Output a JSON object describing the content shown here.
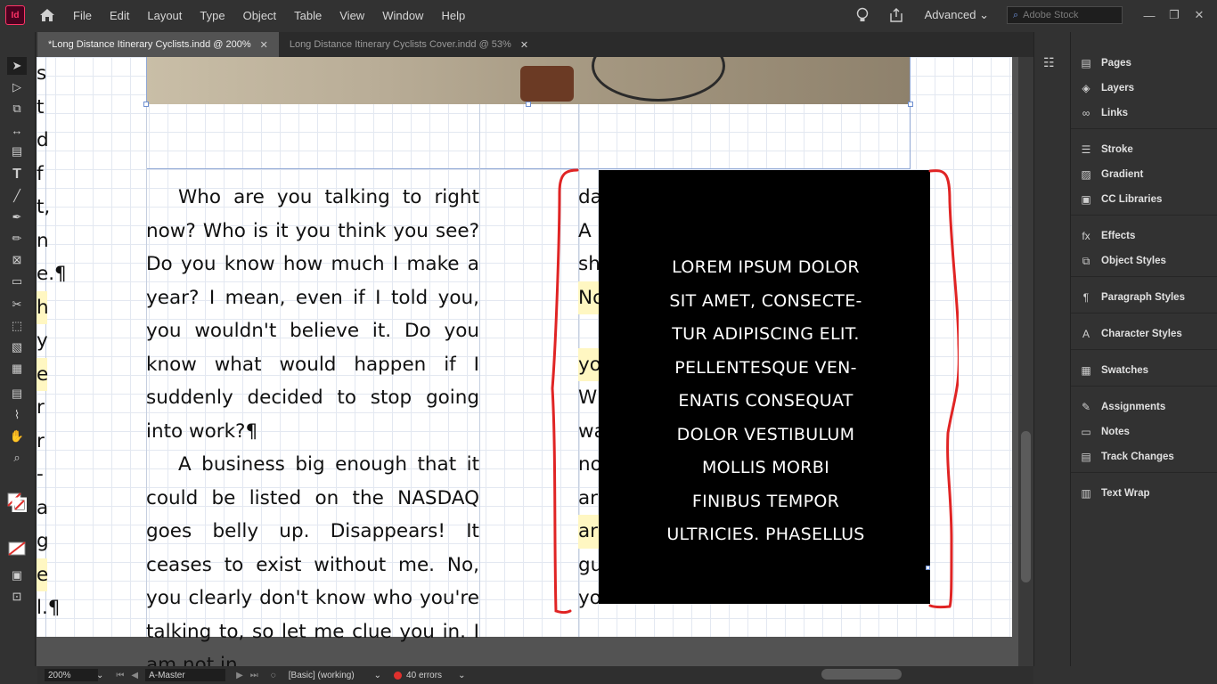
{
  "app": {
    "logo": "Id"
  },
  "menu": [
    "File",
    "Edit",
    "Layout",
    "Type",
    "Object",
    "Table",
    "View",
    "Window",
    "Help"
  ],
  "workspace": "Advanced",
  "stock_placeholder": "Adobe Stock",
  "window_controls": [
    "—",
    "❐",
    "✕"
  ],
  "tabs": [
    {
      "label": "*Long Distance Itinerary Cyclists.indd @ 200%"
    },
    {
      "label": "Long Distance Itinerary Cyclists Cover.indd @ 53%"
    }
  ],
  "tab_close": "✕",
  "left_column_chars": [
    "s",
    "t",
    "d",
    "f",
    "t,",
    "n",
    "e.¶",
    "h",
    "y",
    "e",
    "r",
    "r",
    "-",
    "a",
    "g",
    "e",
    "l.¶"
  ],
  "body": {
    "para1": "Who are you talking to right now? Who is it you think you see? Do you know how much I make a year? I mean, even if I told you, you wouldn't believe it. Do you know what would happen if I suddenly decided to stop going into work?¶",
    "para2": "A business big enough that it could be listed on the NASDAQ goes belly up. Disappears! It ceases to exist without me. No, you clearly don't know who you're talking to, so let me clue you in. I am not in"
  },
  "right_column_fragments": [
    "da",
    "A",
    "sh",
    "No",
    "",
    "yo",
    "W",
    "wa",
    "no",
    "ar",
    "ar",
    "gu",
    "yo"
  ],
  "overlay_text": [
    "LOREM IPSUM DOLOR",
    "SIT AMET, CONSECTE-",
    "TUR ADIPISCING ELIT.",
    "PELLENTESQUE VEN-",
    "ENATIS CONSEQUAT",
    "DOLOR VESTIBULUM",
    "MOLLIS MORBI",
    "FINIBUS TEMPOR",
    "ULTRICIES. PHASELLUS"
  ],
  "panels": [
    {
      "label": "Pages",
      "icon": "pages-icon",
      "glyph": "▤"
    },
    {
      "label": "Layers",
      "icon": "layers-icon",
      "glyph": "◈"
    },
    {
      "label": "Links",
      "icon": "links-icon",
      "glyph": "∞"
    },
    {
      "label": "Stroke",
      "icon": "stroke-icon",
      "glyph": "☰"
    },
    {
      "label": "Gradient",
      "icon": "gradient-icon",
      "glyph": "▨"
    },
    {
      "label": "CC Libraries",
      "icon": "cc-libraries-icon",
      "glyph": "▣"
    },
    {
      "label": "Effects",
      "icon": "effects-icon",
      "glyph": "fx"
    },
    {
      "label": "Object Styles",
      "icon": "object-styles-icon",
      "glyph": "⧉"
    },
    {
      "label": "Paragraph Styles",
      "icon": "paragraph-styles-icon",
      "glyph": "¶"
    },
    {
      "label": "Character Styles",
      "icon": "character-styles-icon",
      "glyph": "A"
    },
    {
      "label": "Swatches",
      "icon": "swatches-icon",
      "glyph": "▦"
    },
    {
      "label": "Assignments",
      "icon": "assignments-icon",
      "glyph": "✎"
    },
    {
      "label": "Notes",
      "icon": "notes-icon",
      "glyph": "▭"
    },
    {
      "label": "Track Changes",
      "icon": "track-changes-icon",
      "glyph": "▤"
    },
    {
      "label": "Text Wrap",
      "icon": "text-wrap-icon",
      "glyph": "▥"
    }
  ],
  "status": {
    "zoom": "200%",
    "page": "A-Master",
    "style": "[Basic] (working)",
    "errors": "40 errors"
  }
}
